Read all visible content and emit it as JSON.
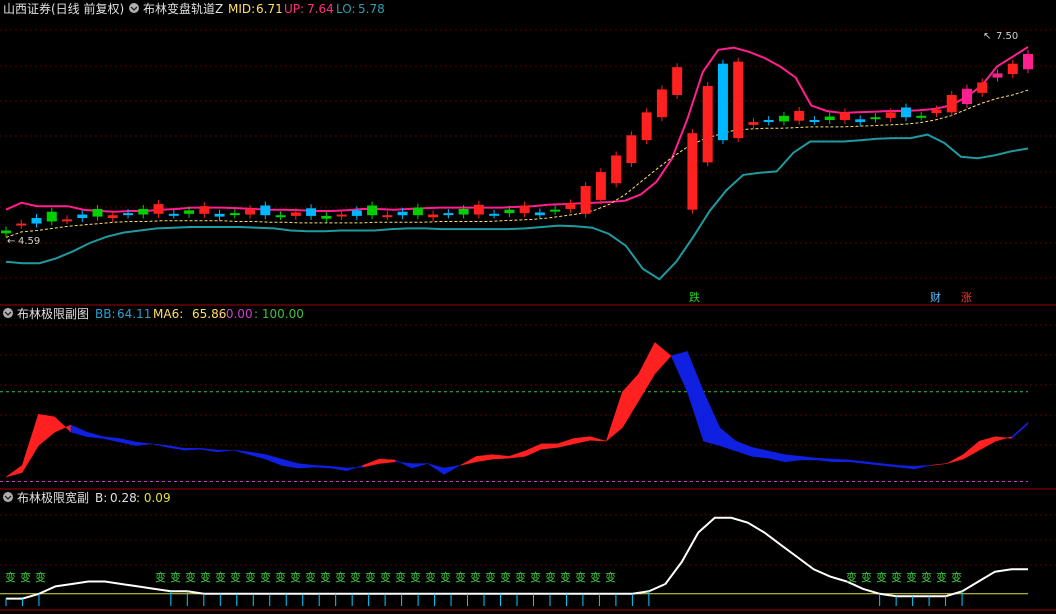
{
  "header": {
    "stock": "山西证券",
    "period": "(日线 前复权)",
    "indicator": "布林变盘轨道Z",
    "mid_label": "MID:",
    "mid_value": "6.71",
    "up_label": "UP:",
    "up_value": "7.64",
    "lo_label": "LO:",
    "lo_value": "5.78"
  },
  "panel2": {
    "title": "布林极限副图",
    "bb_label": "BB:",
    "bb_value": "64.11",
    "ma6_label": "MA6:",
    "ma6_value": "65.86",
    "v3": ": 0.00",
    "v4": ": 100.00"
  },
  "panel3": {
    "title": "布林极限宽副",
    "b_label": "B:",
    "b_value": "0.28",
    "v2": ": 0.09"
  },
  "annotations": {
    "low_price": "4.59",
    "high_price": "7.50",
    "die": "跌",
    "cai": "财",
    "zhang": "涨",
    "bian": "变"
  },
  "colors": {
    "up": "#ff2020",
    "down_cyan": "#00b8ff",
    "green": "#00d000",
    "magenta": "#ff1f8f",
    "teal": "#1f9aa0",
    "mid": "#ffe070",
    "blue": "#1020e0",
    "bg": "#000000",
    "frame": "#a00000"
  },
  "chart_data": [
    {
      "type": "candlestick",
      "title": "布林变盘轨道Z",
      "series": [
        {
          "name": "UP",
          "values": [
            5.3,
            5.4,
            5.35,
            5.35,
            5.35,
            5.3,
            5.28,
            5.27,
            5.28,
            5.28,
            5.3,
            5.31,
            5.33,
            5.33,
            5.33,
            5.32,
            5.31,
            5.3,
            5.3,
            5.29,
            5.28,
            5.28,
            5.29,
            5.31,
            5.31,
            5.3,
            5.31,
            5.32,
            5.33,
            5.33,
            5.33,
            5.33,
            5.33,
            5.34,
            5.35,
            5.37,
            5.38,
            5.39,
            5.4,
            5.41,
            5.43,
            5.52,
            5.7,
            6.03,
            6.6,
            7.28,
            7.6,
            7.63,
            7.57,
            7.48,
            7.36,
            7.2,
            6.8,
            6.72,
            6.69,
            6.7,
            6.71,
            6.72,
            6.72,
            6.73,
            6.75,
            6.8,
            6.92,
            7.08,
            7.36,
            7.5,
            7.64
          ]
        },
        {
          "name": "MID",
          "values": [
            4.9,
            4.98,
            5.0,
            5.03,
            5.06,
            5.08,
            5.1,
            5.12,
            5.13,
            5.13,
            5.14,
            5.14,
            5.14,
            5.14,
            5.14,
            5.13,
            5.13,
            5.12,
            5.12,
            5.11,
            5.11,
            5.11,
            5.11,
            5.11,
            5.12,
            5.12,
            5.12,
            5.12,
            5.13,
            5.13,
            5.13,
            5.13,
            5.14,
            5.15,
            5.16,
            5.18,
            5.21,
            5.24,
            5.29,
            5.38,
            5.52,
            5.7,
            5.88,
            6.05,
            6.2,
            6.31,
            6.38,
            6.44,
            6.46,
            6.47,
            6.47,
            6.48,
            6.49,
            6.49,
            6.49,
            6.5,
            6.51,
            6.52,
            6.53,
            6.55,
            6.59,
            6.65,
            6.74,
            6.83,
            6.9,
            6.95,
            7.02
          ]
        },
        {
          "name": "LO",
          "values": [
            4.55,
            4.53,
            4.53,
            4.6,
            4.7,
            4.82,
            4.91,
            4.97,
            5.0,
            5.03,
            5.04,
            5.05,
            5.05,
            5.05,
            5.05,
            5.04,
            5.03,
            5.0,
            4.99,
            4.99,
            5.0,
            5.0,
            5.0,
            5.02,
            5.03,
            5.03,
            5.02,
            5.02,
            5.02,
            5.02,
            5.02,
            5.03,
            5.05,
            5.07,
            5.06,
            5.04,
            4.95,
            4.78,
            4.45,
            4.3,
            4.55,
            4.9,
            5.28,
            5.58,
            5.8,
            5.83,
            5.85,
            6.12,
            6.28,
            6.28,
            6.28,
            6.3,
            6.32,
            6.33,
            6.33,
            6.38,
            6.26,
            6.06,
            6.04,
            6.08,
            6.14,
            6.18
          ]
        }
      ],
      "y_range": [
        4.0,
        8.0
      ],
      "labels": [
        "4.59",
        "7.50"
      ]
    },
    {
      "type": "area",
      "title": "布林极限副图",
      "series": [
        {
          "name": "BB",
          "values": [
            5,
            18,
            75,
            72,
            55,
            50,
            48,
            44,
            40,
            42,
            38,
            35,
            36,
            33,
            35,
            30,
            25,
            18,
            15,
            16,
            15,
            12,
            18,
            25,
            24,
            15,
            20,
            8,
            18,
            28,
            30,
            28,
            34,
            42,
            42,
            48,
            50,
            45,
            100,
            120,
            155,
            140,
            100,
            45,
            40,
            34,
            28,
            26,
            22,
            24,
            24,
            22,
            22,
            20,
            18,
            16,
            14,
            18,
            20,
            30,
            45,
            50,
            48,
            64
          ]
        },
        {
          "name": "MA6",
          "values": [
            5,
            10,
            40,
            55,
            63,
            55,
            50,
            48,
            44,
            42,
            40,
            37,
            37,
            35,
            35,
            33,
            30,
            25,
            20,
            18,
            17,
            15,
            16,
            20,
            22,
            20,
            20,
            15,
            18,
            22,
            25,
            26,
            28,
            36,
            38,
            42,
            46,
            45,
            60,
            90,
            120,
            140,
            145,
            100,
            60,
            45,
            38,
            34,
            30,
            28,
            26,
            25,
            24,
            22,
            20,
            18,
            17,
            18,
            20,
            25,
            35,
            45,
            50,
            66
          ]
        }
      ],
      "reference_lines": [
        0,
        100
      ],
      "y_range": [
        -5,
        180
      ]
    },
    {
      "type": "line",
      "title": "布林极限宽副",
      "series": [
        {
          "name": "B",
          "values": [
            0.03,
            0.03,
            0.05,
            0.08,
            0.09,
            0.1,
            0.1,
            0.09,
            0.08,
            0.07,
            0.06,
            0.06,
            0.05,
            0.05,
            0.05,
            0.05,
            0.05,
            0.05,
            0.05,
            0.05,
            0.05,
            0.05,
            0.05,
            0.05,
            0.05,
            0.05,
            0.05,
            0.05,
            0.05,
            0.05,
            0.05,
            0.05,
            0.05,
            0.05,
            0.05,
            0.05,
            0.05,
            0.05,
            0.05,
            0.06,
            0.09,
            0.18,
            0.3,
            0.36,
            0.36,
            0.34,
            0.3,
            0.25,
            0.2,
            0.15,
            0.12,
            0.1,
            0.07,
            0.05,
            0.04,
            0.04,
            0.04,
            0.04,
            0.06,
            0.1,
            0.14,
            0.15,
            0.15
          ]
        }
      ],
      "y_range": [
        0,
        0.4
      ]
    }
  ]
}
